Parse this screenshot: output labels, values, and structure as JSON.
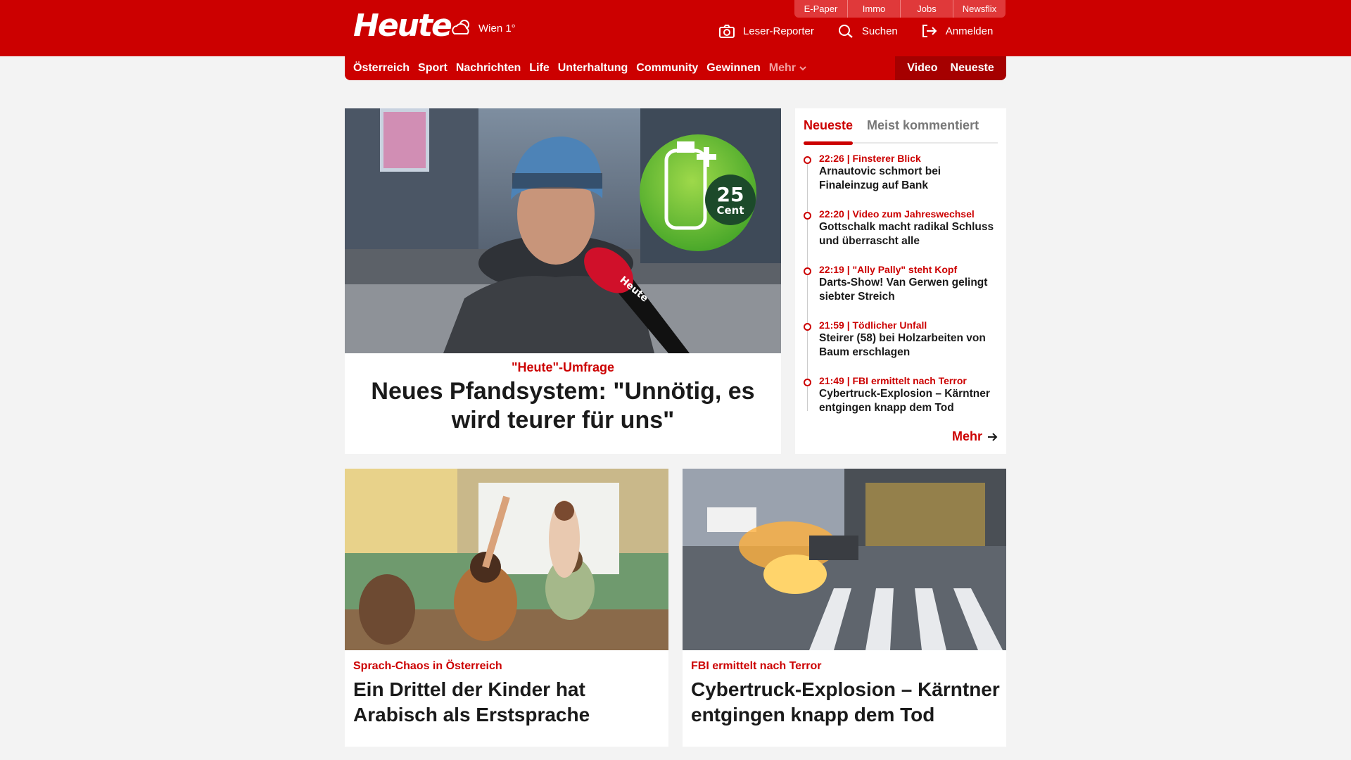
{
  "brand": {
    "logo": "Heute",
    "weather": "Wien 1°"
  },
  "service_links": [
    "E-Paper",
    "Immo",
    "Jobs",
    "Newsflix"
  ],
  "utilities": [
    {
      "label": "Leser-Reporter",
      "icon": "camera-icon"
    },
    {
      "label": "Suchen",
      "icon": "search-icon"
    },
    {
      "label": "Anmelden",
      "icon": "login-icon"
    }
  ],
  "nav": {
    "items": [
      "Österreich",
      "Sport",
      "Nachrichten",
      "Life",
      "Unterhaltung",
      "Community",
      "Gewinnen"
    ],
    "more": "Mehr",
    "right": [
      "Video",
      "Neueste"
    ]
  },
  "hero": {
    "kicker": "\"Heute\"-Umfrage",
    "title": "Neues Pfandsystem: \"Unnötig, es wird teurer für uns\"",
    "badge_value": "25",
    "badge_unit": "Cent",
    "mic_label": "Heute"
  },
  "sidebar": {
    "tabs": [
      "Neueste",
      "Meist kommentiert"
    ],
    "items": [
      {
        "meta": "22:26 | Finsterer Blick",
        "title": "Arnautovic schmort bei Finaleinzug auf Bank"
      },
      {
        "meta": "22:20 | Video zum Jahreswechsel",
        "title": "Gottschalk macht radikal Schluss und überrascht alle"
      },
      {
        "meta": "22:19 | \"Ally Pally\" steht Kopf",
        "title": "Darts-Show! Van Gerwen gelingt siebter Streich"
      },
      {
        "meta": "21:59 | Tödlicher Unfall",
        "title": "Steirer (58) bei Holzarbeiten von Baum erschlagen"
      },
      {
        "meta": "21:49 | FBI ermittelt nach Terror",
        "title": "Cybertruck-Explosion – Kärntner entgingen knapp dem Tod"
      }
    ],
    "more": "Mehr"
  },
  "cards": [
    {
      "kicker": "Sprach-Chaos in Österreich",
      "title": "Ein Drittel der Kinder hat Arabisch als Erstsprache"
    },
    {
      "kicker": "FBI ermittelt nach Terror",
      "title": "Cybertruck-Explosion – Kärntner entgingen knapp dem Tod"
    }
  ],
  "colors": {
    "brand_red": "#cc0000",
    "dark_red": "#a50000",
    "background": "#f3f3f3"
  }
}
